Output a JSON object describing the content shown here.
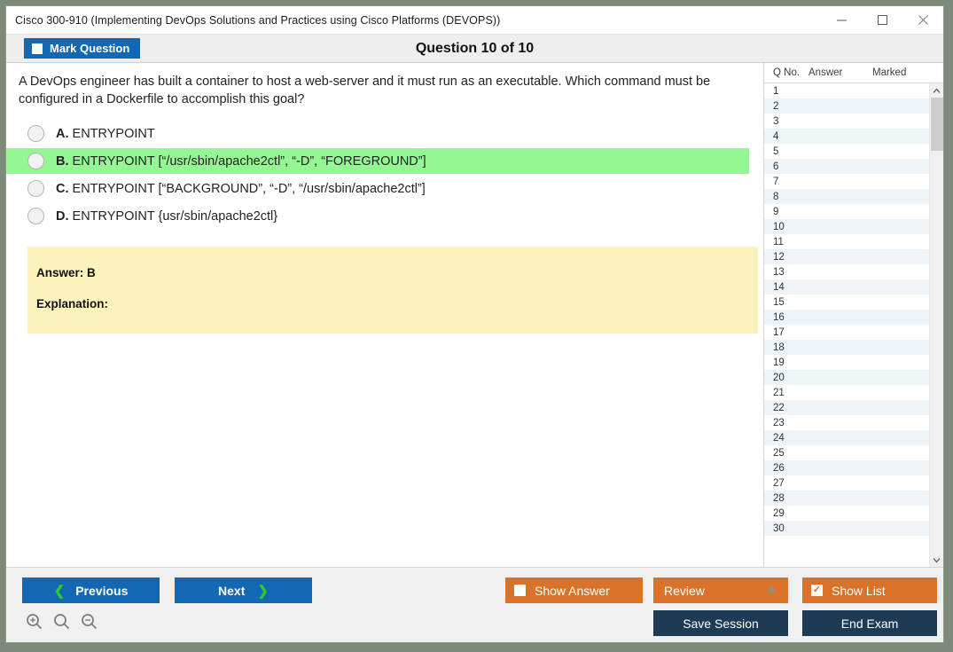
{
  "window": {
    "title": "Cisco 300-910 (Implementing DevOps Solutions and Practices using Cisco Platforms (DEVOPS))",
    "minimize_icon": "minimize-icon",
    "maximize_icon": "maximize-icon",
    "close_icon": "close-icon"
  },
  "header": {
    "mark_question_label": "Mark Question",
    "question_counter": "Question 10 of 10"
  },
  "question": {
    "text": "A DevOps engineer has built a container to host a web-server and it must run as an executable. Which command must be configured in a Dockerfile to accomplish this goal?",
    "options": [
      {
        "letter": "A.",
        "text": "ENTRYPOINT",
        "selected": false
      },
      {
        "letter": "B.",
        "text": "ENTRYPOINT [“/usr/sbin/apache2ctl”, “-D”, “FOREGROUND”]",
        "selected": true
      },
      {
        "letter": "C.",
        "text": "ENTRYPOINT [“BACKGROUND”, “-D”, “/usr/sbin/apache2ctl”]",
        "selected": false
      },
      {
        "letter": "D.",
        "text": "ENTRYPOINT {usr/sbin/apache2ctl}",
        "selected": false
      }
    ]
  },
  "answer_box": {
    "answer_line": "Answer: B",
    "explanation_line": "Explanation:"
  },
  "list_panel": {
    "columns": [
      "Q No.",
      "Answer",
      "Marked"
    ],
    "rows": [
      {
        "q_no": "1",
        "answer": "",
        "marked": ""
      },
      {
        "q_no": "2",
        "answer": "",
        "marked": ""
      },
      {
        "q_no": "3",
        "answer": "",
        "marked": ""
      },
      {
        "q_no": "4",
        "answer": "",
        "marked": ""
      },
      {
        "q_no": "5",
        "answer": "",
        "marked": ""
      },
      {
        "q_no": "6",
        "answer": "",
        "marked": ""
      },
      {
        "q_no": "7",
        "answer": "",
        "marked": ""
      },
      {
        "q_no": "8",
        "answer": "",
        "marked": ""
      },
      {
        "q_no": "9",
        "answer": "",
        "marked": ""
      },
      {
        "q_no": "10",
        "answer": "",
        "marked": ""
      },
      {
        "q_no": "11",
        "answer": "",
        "marked": ""
      },
      {
        "q_no": "12",
        "answer": "",
        "marked": ""
      },
      {
        "q_no": "13",
        "answer": "",
        "marked": ""
      },
      {
        "q_no": "14",
        "answer": "",
        "marked": ""
      },
      {
        "q_no": "15",
        "answer": "",
        "marked": ""
      },
      {
        "q_no": "16",
        "answer": "",
        "marked": ""
      },
      {
        "q_no": "17",
        "answer": "",
        "marked": ""
      },
      {
        "q_no": "18",
        "answer": "",
        "marked": ""
      },
      {
        "q_no": "19",
        "answer": "",
        "marked": ""
      },
      {
        "q_no": "20",
        "answer": "",
        "marked": ""
      },
      {
        "q_no": "21",
        "answer": "",
        "marked": ""
      },
      {
        "q_no": "22",
        "answer": "",
        "marked": ""
      },
      {
        "q_no": "23",
        "answer": "",
        "marked": ""
      },
      {
        "q_no": "24",
        "answer": "",
        "marked": ""
      },
      {
        "q_no": "25",
        "answer": "",
        "marked": ""
      },
      {
        "q_no": "26",
        "answer": "",
        "marked": ""
      },
      {
        "q_no": "27",
        "answer": "",
        "marked": ""
      },
      {
        "q_no": "28",
        "answer": "",
        "marked": ""
      },
      {
        "q_no": "29",
        "answer": "",
        "marked": ""
      },
      {
        "q_no": "30",
        "answer": "",
        "marked": ""
      }
    ],
    "scroll_up_icon": "chevron-up-icon",
    "scroll_down_icon": "chevron-down-icon"
  },
  "footer": {
    "previous_label": "Previous",
    "next_label": "Next",
    "show_answer_label": "Show Answer",
    "show_answer_checked": false,
    "review_label": "Review",
    "review_caret_icon": "caret-up-icon",
    "show_list_label": "Show List",
    "show_list_checked": true,
    "save_session_label": "Save Session",
    "end_exam_label": "End Exam",
    "zoom_in_icon": "zoom-in-icon",
    "zoom_reset_icon": "zoom-reset-icon",
    "zoom_out_icon": "zoom-out-icon"
  },
  "colors": {
    "primary_blue": "#1268b3",
    "accent_orange": "#db722a",
    "dark_navy": "#1d3b55",
    "selected_green": "#95f793",
    "answer_yellow": "#fbf3bb",
    "chevron_green": "#2ecc2e"
  }
}
